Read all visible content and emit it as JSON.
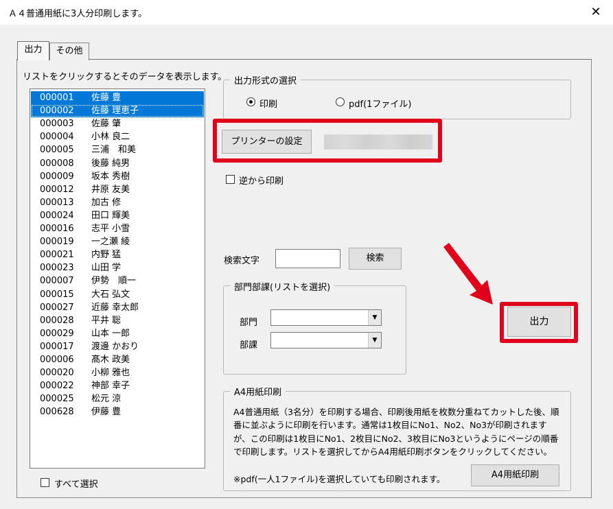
{
  "window": {
    "title": "Ａ４普通用紙に3人分印刷します。",
    "close_glyph": "✕"
  },
  "tabs": [
    {
      "label": "出力",
      "active": true
    },
    {
      "label": "その他",
      "active": false
    }
  ],
  "list": {
    "caption": "リストをクリックするとそのデータを表示します。",
    "rows": [
      {
        "id": "000001",
        "name": "佐藤 豊",
        "selected": true
      },
      {
        "id": "000002",
        "name": "佐藤 理恵子",
        "selected": true
      },
      {
        "id": "000003",
        "name": "佐藤 肇",
        "selected": false
      },
      {
        "id": "000004",
        "name": "小林 良二",
        "selected": false
      },
      {
        "id": "000005",
        "name": "三浦　和美",
        "selected": false
      },
      {
        "id": "000008",
        "name": "後藤 純男",
        "selected": false
      },
      {
        "id": "000009",
        "name": "坂本 秀樹",
        "selected": false
      },
      {
        "id": "000012",
        "name": "井原 友美",
        "selected": false
      },
      {
        "id": "000013",
        "name": "加古 修",
        "selected": false
      },
      {
        "id": "000024",
        "name": "田口 輝美",
        "selected": false
      },
      {
        "id": "000016",
        "name": "志平 小雪",
        "selected": false
      },
      {
        "id": "000019",
        "name": "一之瀬 綾",
        "selected": false
      },
      {
        "id": "000021",
        "name": "内野 猛",
        "selected": false
      },
      {
        "id": "000023",
        "name": "山田 学",
        "selected": false
      },
      {
        "id": "000007",
        "name": "伊勢　順一",
        "selected": false
      },
      {
        "id": "000015",
        "name": "大石 弘文",
        "selected": false
      },
      {
        "id": "000027",
        "name": "近藤 幸太郎",
        "selected": false
      },
      {
        "id": "000028",
        "name": "平井 聡",
        "selected": false
      },
      {
        "id": "000029",
        "name": "山本 一郎",
        "selected": false
      },
      {
        "id": "000017",
        "name": "渡邊 かおり",
        "selected": false
      },
      {
        "id": "000006",
        "name": "髙木 政美",
        "selected": false
      },
      {
        "id": "000020",
        "name": "小柳 雅也",
        "selected": false
      },
      {
        "id": "000022",
        "name": "神部 幸子",
        "selected": false
      },
      {
        "id": "000025",
        "name": "松元 涼",
        "selected": false
      },
      {
        "id": "000628",
        "name": "伊藤 豊",
        "selected": false
      }
    ],
    "select_all_label": "すべて選択",
    "select_all_checked": false
  },
  "output_format": {
    "legend": "出力形式の選択",
    "options": [
      {
        "label": "印刷",
        "checked": true
      },
      {
        "label": "pdf(1ファイル)",
        "checked": false
      }
    ]
  },
  "printer": {
    "button_label": "プリンターの設定"
  },
  "reverse_print": {
    "label": "逆から印刷",
    "checked": false
  },
  "search": {
    "label": "検索文字",
    "value": "",
    "button_label": "検索"
  },
  "department": {
    "legend": "部門部課(リストを選択)",
    "dept_label": "部門",
    "dept_value": "",
    "section_label": "部課",
    "section_value": ""
  },
  "output_button_label": "出力",
  "a4": {
    "legend": "A4用紙印刷",
    "description": "A4普通用紙（3名分）を印刷する場合、印刷後用紙を枚数分重ねてカットした後、順番に並ぶように印刷を行います。通常は1枚目にNo1、No2、No3が印刷されますが、この印刷は1枚目にNo1、2枚目にNo2、3枚目にNo3というようにページの順番で印刷します。リストを選択してからA4用紙印刷ボタンをクリックしてください。",
    "note": "※pdf(一人1ファイル)を選択していても印刷されます。",
    "button_label": "A4用紙印刷"
  },
  "colors": {
    "highlight_red": "#e1001c",
    "selection_blue": "#0078d7",
    "dialog_bg": "#f0f0f0"
  }
}
